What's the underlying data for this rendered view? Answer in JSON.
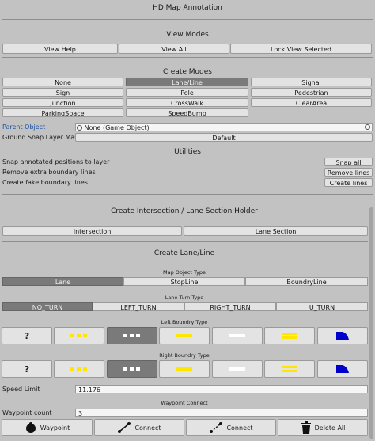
{
  "window": {
    "title": "HD Map Annotation"
  },
  "view_modes": {
    "heading": "View Modes",
    "buttons": [
      "View Help",
      "View All",
      "Lock View Selected"
    ]
  },
  "create_modes": {
    "heading": "Create Modes",
    "selected": "Lane/Line",
    "buttons": [
      "None",
      "Lane/Line",
      "Signal",
      "Sign",
      "Pole",
      "Pedestrian",
      "Junction",
      "CrossWalk",
      "ClearArea",
      "ParkingSpace",
      "SpeedBump"
    ]
  },
  "parent_object": {
    "label": "Parent Object",
    "value": "None (Game Object)"
  },
  "ground_snap": {
    "label": "Ground Snap Layer Mask",
    "value": "Default"
  },
  "utilities": {
    "heading": "Utilities",
    "rows": [
      {
        "label": "Snap annotated positions to layer",
        "button": "Snap all"
      },
      {
        "label": "Remove extra boundary lines",
        "button": "Remove lines"
      },
      {
        "label": "Create fake boundary lines",
        "button": "Create lines"
      }
    ]
  },
  "intersection_section": {
    "heading": "Create Intersection / Lane Section Holder",
    "buttons": [
      "Intersection",
      "Lane Section"
    ]
  },
  "lane_line": {
    "heading": "Create Lane/Line",
    "map_object_type": {
      "label": "Map Object Type",
      "options": [
        "Lane",
        "StopLine",
        "BoundryLine"
      ],
      "selected": "Lane"
    },
    "lane_turn_type": {
      "label": "Lane Turn Type",
      "options": [
        "NO_TURN",
        "LEFT_TURN",
        "RIGHT_TURN",
        "U_TURN"
      ],
      "selected": "NO_TURN"
    },
    "left_boundry": {
      "label": "Left Boundry Type",
      "unknown_glyph": "?",
      "selected_index": 2
    },
    "right_boundry": {
      "label": "Right Boundry Type",
      "unknown_glyph": "?",
      "selected_index": 2
    },
    "boundry_icons": [
      "unknown-icon",
      "dashed-yellow-icon",
      "dashed-white-icon",
      "solid-yellow-icon",
      "solid-white-icon",
      "double-yellow-icon",
      "curb-icon"
    ],
    "colors": {
      "yellow": "#ffe600",
      "white": "#ffffff",
      "blue": "#0000cc"
    },
    "speed_limit": {
      "label": "Speed Limit",
      "value": "11.176"
    },
    "waypoint_connect": {
      "label": "Waypoint Connect"
    },
    "waypoint_count": {
      "label": "Waypoint count",
      "value": "3"
    }
  },
  "actions": [
    "Waypoint",
    "Connect",
    "Connect",
    "Delete All"
  ]
}
